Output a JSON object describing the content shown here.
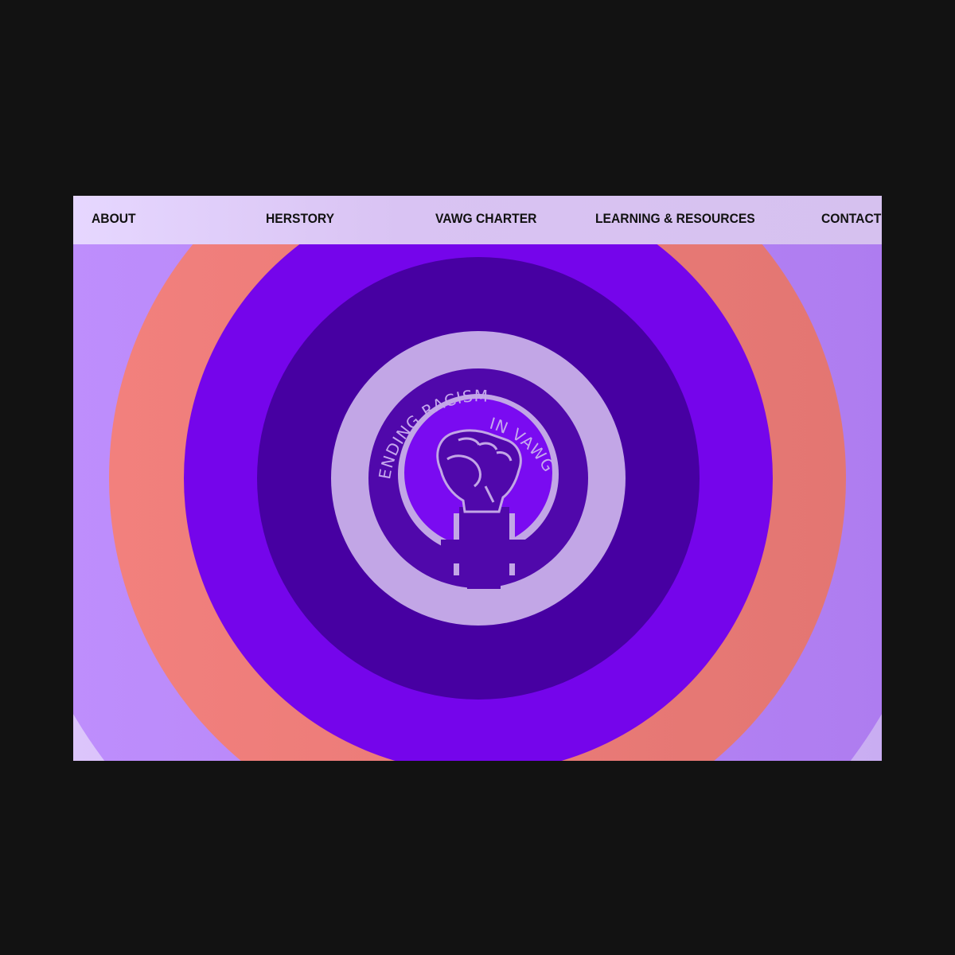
{
  "nav": {
    "items": [
      {
        "label": "ABOUT"
      },
      {
        "label": "HERSTORY"
      },
      {
        "label": "VAWG CHARTER"
      },
      {
        "label": "LEARNING & RESOURCES"
      },
      {
        "label": "CONTACT"
      }
    ]
  },
  "hero": {
    "emblem": {
      "text_top": "ENDING RACISM",
      "text_side": "IN VAWG",
      "icon": "raised-fist-venus-icon"
    },
    "colors": {
      "outer_lilac": "#d8c2f8",
      "lavender": "#b98cf8",
      "coral": "#ee7b77",
      "violet": "#7505eb",
      "deep_purple": "#4700a2",
      "pale_ring": "#c2a6e6",
      "emblem_purple": "#5008ab",
      "inner_violet": "#7a0bf1"
    }
  }
}
